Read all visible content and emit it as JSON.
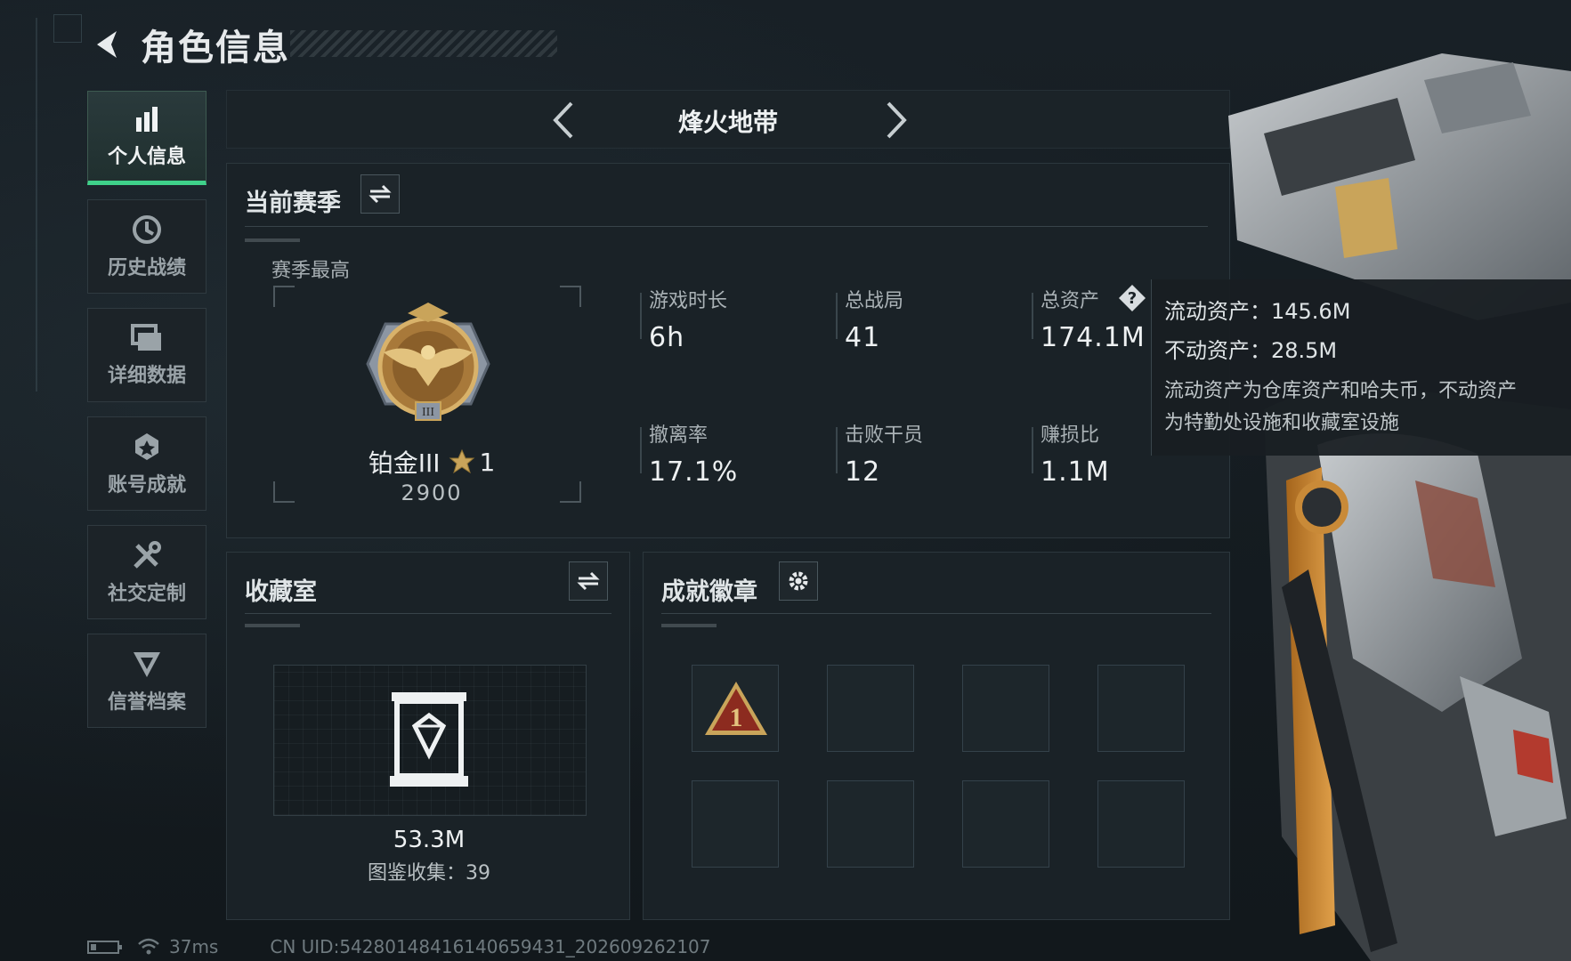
{
  "header": {
    "title": "角色信息"
  },
  "sidebar": {
    "items": [
      {
        "label": "个人信息",
        "active": true,
        "icon": "bar-chart-icon"
      },
      {
        "label": "历史战绩",
        "active": false,
        "icon": "history-icon"
      },
      {
        "label": "详细数据",
        "active": false,
        "icon": "data-icon"
      },
      {
        "label": "账号成就",
        "active": false,
        "icon": "achievement-icon"
      },
      {
        "label": "社交定制",
        "active": false,
        "icon": "tools-icon"
      },
      {
        "label": "信誉档案",
        "active": false,
        "icon": "reputation-icon"
      }
    ]
  },
  "mode": {
    "title": "烽火地带"
  },
  "season": {
    "panel_title": "当前赛季",
    "best_label": "赛季最高",
    "rank_name": "铂金III",
    "rank_stars": "1",
    "rank_score": "2900",
    "stats": [
      {
        "label": "游戏时长",
        "value": "6h"
      },
      {
        "label": "总战局",
        "value": "41"
      },
      {
        "label": "总资产",
        "value": "174.1M"
      },
      {
        "label": "撤离率",
        "value": "17.1%"
      },
      {
        "label": "击败干员",
        "value": "12"
      },
      {
        "label": "赚损比",
        "value": "1.1M"
      }
    ]
  },
  "tooltip": {
    "liquid": "流动资产：145.6M",
    "fixed": "不动资产：28.5M",
    "note_line1": "流动资产为仓库资产和哈夫币，不动资产",
    "note_line2": "为特勤处设施和收藏室设施"
  },
  "collection": {
    "panel_title": "收藏室",
    "value": "53.3M",
    "catalog": "图鉴收集：39"
  },
  "badges": {
    "panel_title": "成就徽章",
    "slots": 8,
    "filled_badge": "rank-1-triangle-badge"
  },
  "footer": {
    "ping": "37ms",
    "uid": "CN UID:5428014841614065943​1_202609262107"
  },
  "colors": {
    "accent": "#3fd18a",
    "gold": "#c9a45a",
    "badge_red": "#8c2b1f"
  }
}
